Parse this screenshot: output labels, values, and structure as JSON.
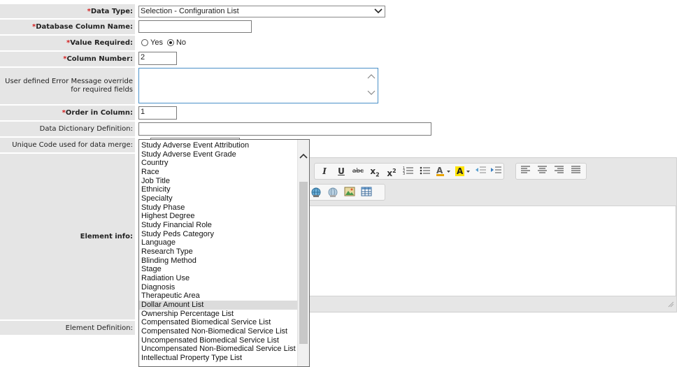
{
  "fields": {
    "data_type": {
      "label": "Data Type:",
      "value": "Selection - Configuration List"
    },
    "db_column_name": {
      "label": "Database Column Name:",
      "value": ""
    },
    "value_required": {
      "label": "Value Required:",
      "options": [
        "Yes",
        "No"
      ],
      "selected": "No"
    },
    "column_number": {
      "label": "Column Number:",
      "value": "2"
    },
    "error_override": {
      "label": "User defined Error Message override for required fields",
      "value": ""
    },
    "order_in_column": {
      "label": "Order in Column:",
      "value": "1"
    },
    "dictionary_def": {
      "label": "Data Dictionary Definition:",
      "value": ""
    },
    "unique_code": {
      "label": "Unique Code used for data merge:",
      "value": ""
    },
    "element_info": {
      "label": "Element info:"
    },
    "element_def": {
      "label": "Element Definition:"
    }
  },
  "required_marker": "*",
  "editor": {
    "toolbar_icons": [
      "italic-icon",
      "underline-icon",
      "strikethrough-icon",
      "subscript-icon",
      "superscript-icon",
      "numbered-list-icon",
      "bullet-list-icon",
      "text-color-icon",
      "highlight-color-icon",
      "outdent-icon",
      "indent-icon",
      "align-left-icon",
      "align-center-icon",
      "align-right-icon",
      "justify-icon",
      "link-icon",
      "unlink-icon",
      "image-icon",
      "table-icon"
    ]
  },
  "dropdown": {
    "selected": "Dollar Amount List",
    "options": [
      "Study Adverse Event Attribution",
      "Study Adverse Event Grade",
      "Country",
      "Race",
      "Job Title",
      "Ethnicity",
      "Specialty",
      "Study Phase",
      "Highest Degree",
      "Study Financial Role",
      "Study Peds Category",
      "Language",
      "Research Type",
      "Blinding Method",
      "Stage",
      "Radiation Use",
      "Diagnosis",
      "Therapeutic Area",
      "Dollar Amount List",
      "Ownership Percentage List",
      "Compensated Biomedical Service List",
      "Compensated Non-Biomedical Service List",
      "Uncompensated Biomedical Service List",
      "Uncompensated Non-Biomedical Service List",
      "Intellectual Property Type List"
    ]
  },
  "colors": {
    "label_bg": "#e5e5e5",
    "required": "#d31f1f",
    "focus_border": "#4a90c8"
  }
}
